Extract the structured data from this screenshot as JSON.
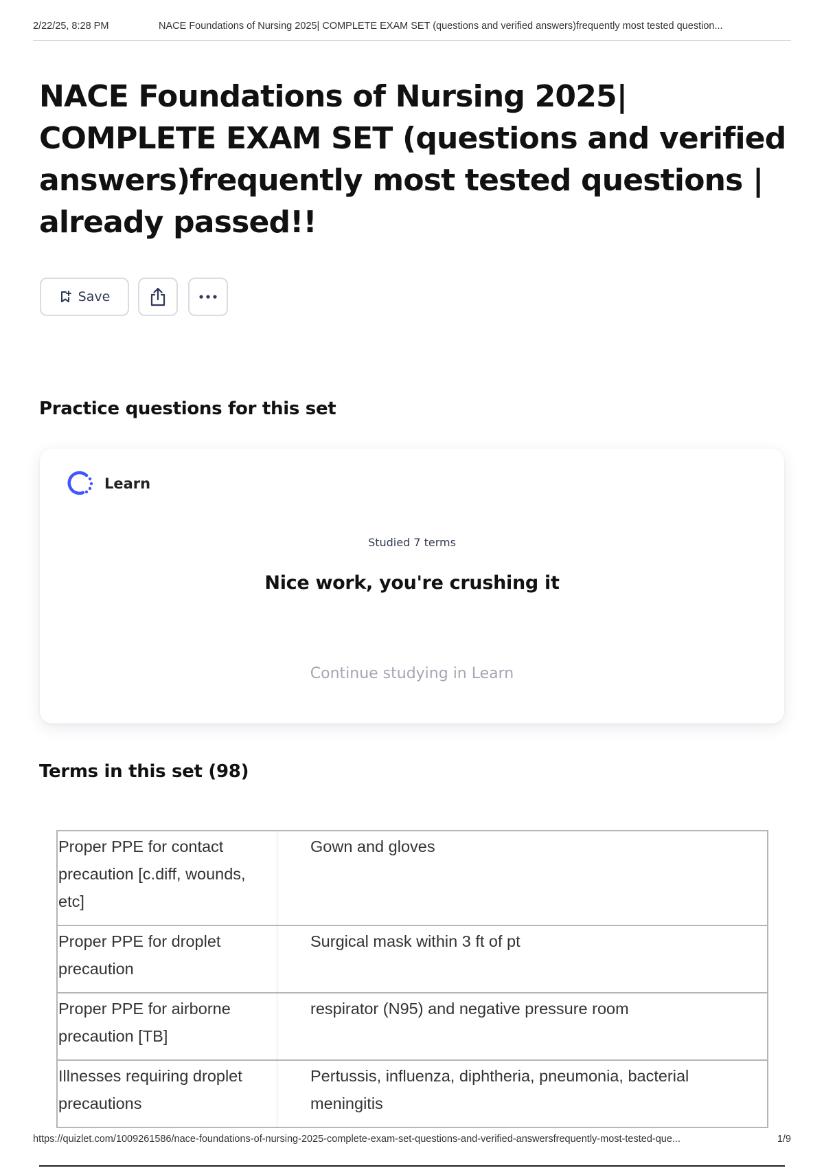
{
  "print_header": {
    "datetime": "2/22/25, 8:28 PM",
    "title": "NACE Foundations of Nursing 2025| COMPLETE EXAM SET (questions and verified answers)frequently most tested question..."
  },
  "page_title": "NACE Foundations of Nursing 2025| COMPLETE EXAM SET (questions and verified answers)frequently most tested questions | already passed!!",
  "actions": {
    "save_label": "Save",
    "save_icon": "bookmark-add-icon",
    "share_icon": "share-icon",
    "more_icon": "more-options-icon"
  },
  "practice": {
    "heading": "Practice questions for this set",
    "mode_label": "Learn",
    "mode_icon": "learn-progress-icon",
    "accent_color": "#4255ff",
    "studied_text": "Studied 7 terms",
    "encouragement": "Nice work, you're crushing it",
    "continue_label": "Continue studying in Learn"
  },
  "terms": {
    "heading": "Terms in this set (98)",
    "rows": [
      {
        "term": "Proper PPE for contact precaution [c.diff, wounds, etc]",
        "definition": "Gown and gloves"
      },
      {
        "term": "Proper PPE for droplet precaution",
        "definition": "Surgical mask within 3 ft of pt"
      },
      {
        "term": "Proper PPE for airborne precaution [TB]",
        "definition": "respirator (N95) and negative pressure room"
      },
      {
        "term": "Illnesses requiring droplet precautions",
        "definition": "Pertussis, influenza, diphtheria, pneumonia, bacterial meningitis"
      }
    ]
  },
  "print_footer": {
    "url": "https://quizlet.com/1009261586/nace-foundations-of-nursing-2025-complete-exam-set-questions-and-verified-answersfrequently-most-tested-que...",
    "page": "1/9"
  }
}
